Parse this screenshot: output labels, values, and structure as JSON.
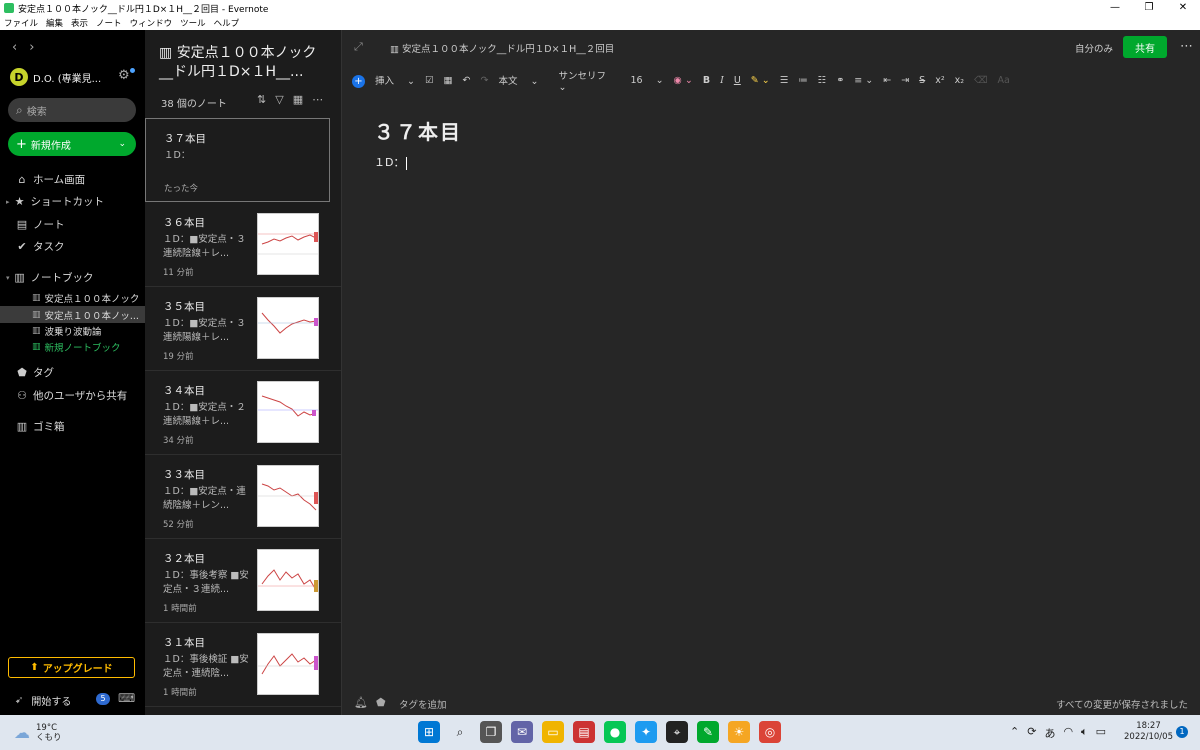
{
  "window": {
    "title": "安定点１００本ノック__ドル円１D×１H__２回目 - Evernote",
    "controls": [
      "—",
      "❐",
      "✕"
    ]
  },
  "menu": [
    "ファイル",
    "編集",
    "表示",
    "ノート",
    "ウィンドウ",
    "ツール",
    "ヘルプ"
  ],
  "sidebar": {
    "account_initial": "D",
    "account_name": "D.O. (専業見...",
    "search_placeholder": "検索",
    "new_label": "新規作成",
    "items": [
      {
        "label": "ホーム画面",
        "icon": "home-icon",
        "glyph": "⌂"
      },
      {
        "label": "ショートカット",
        "icon": "star-icon",
        "glyph": "★"
      },
      {
        "label": "ノート",
        "icon": "note-icon",
        "glyph": "▤"
      },
      {
        "label": "タスク",
        "icon": "task-icon",
        "glyph": "✔"
      },
      {
        "label": "ノートブック",
        "icon": "notebook-icon",
        "glyph": "▥"
      }
    ],
    "notebooks": [
      {
        "label": "安定点１００本ノック"
      },
      {
        "label": "安定点１００本ノッ..."
      },
      {
        "label": "波乗り波動論"
      },
      {
        "label": "新規ノートブック"
      }
    ],
    "items2": [
      {
        "label": "タグ",
        "glyph": "⬟"
      },
      {
        "label": "他のユーザから共有",
        "glyph": "👥"
      },
      {
        "label": "ゴミ箱",
        "glyph": "🗑"
      }
    ],
    "upgrade_label": "アップグレード",
    "get_started_label": "開始する",
    "get_started_badge": "5"
  },
  "notelist": {
    "title": "安定点１００本ノック__ドル円１D×１H__...",
    "count": "38 個のノート",
    "notes": [
      {
        "title": "３７本目",
        "snippet": "１D：",
        "date": "たった今"
      },
      {
        "title": "３６本目",
        "snippet": "１D：■安定点・３連続陰線＋レ...",
        "date": "11 分前"
      },
      {
        "title": "３５本目",
        "snippet": "１D：■安定点・３連続陽線＋レ...",
        "date": "19 分前"
      },
      {
        "title": "３４本目",
        "snippet": "１D：■安定点・２連続陽線＋レ...",
        "date": "34 分前"
      },
      {
        "title": "３３本目",
        "snippet": "１D：■安定点・連続陰線＋レン...",
        "date": "52 分前"
      },
      {
        "title": "３２本目",
        "snippet": "１D：事後考察 ■安定点・３連続...",
        "date": "1 時間前"
      },
      {
        "title": "３１本目",
        "snippet": "１D：事後検証 ■安定点・連続陰...",
        "date": "1 時間前"
      }
    ]
  },
  "editor": {
    "breadcrumb": "安定点１００本ノック__ドル円１D×１H__２回目",
    "visibility": "自分のみ",
    "share_label": "共有",
    "toolbar": {
      "insert": "挿入",
      "style": "本文",
      "font": "サンセリフ",
      "size": "16"
    },
    "note_title": "３７本目",
    "note_body": "１D：",
    "add_tag": "タグを追加",
    "saved_status": "すべての変更が保存されました"
  },
  "taskbar": {
    "temp": "19°C",
    "weather": "くもり",
    "ime": "あ",
    "time": "18:27",
    "date": "2022/10/05",
    "notifications": "1"
  }
}
